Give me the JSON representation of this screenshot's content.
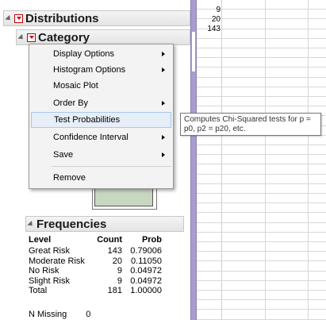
{
  "report": {
    "distributions_title": "Distributions",
    "category_title": "Category",
    "frequencies_title": "Frequencies",
    "freq_headers": {
      "level": "Level",
      "count": "Count",
      "prob": "Prob"
    },
    "freq_rows": [
      {
        "level": "Great Risk",
        "count": "143",
        "prob": "0.79006"
      },
      {
        "level": "Moderate Risk",
        "count": "20",
        "prob": "0.11050"
      },
      {
        "level": "No Risk",
        "count": "9",
        "prob": "0.04972"
      },
      {
        "level": "Slight Risk",
        "count": "9",
        "prob": "0.04972"
      },
      {
        "level": "Total",
        "count": "181",
        "prob": "1.00000"
      }
    ],
    "missing_label": "N Missing",
    "missing_value": "0"
  },
  "menu": {
    "items": [
      {
        "label": "Display Options",
        "submenu": true
      },
      {
        "label": "Histogram Options",
        "submenu": true
      },
      {
        "label": "Mosaic Plot",
        "submenu": false
      },
      {
        "label": "Order By",
        "submenu": true
      },
      {
        "label": "Test Probabilities",
        "submenu": false,
        "highlighted": true
      },
      {
        "label": "Confidence Interval",
        "submenu": true
      },
      {
        "label": "Save",
        "submenu": true
      },
      {
        "label": "Remove",
        "submenu": false
      }
    ]
  },
  "tooltip": {
    "text": "Computes Chi-Squared tests for p = p0, p2 = p20, etc."
  },
  "grid": {
    "values": [
      "9",
      "20",
      "143"
    ]
  },
  "colors": {
    "splitter": "#a89cd0",
    "menu_highlight": "#e6eef8",
    "red_button": "#d00000"
  }
}
